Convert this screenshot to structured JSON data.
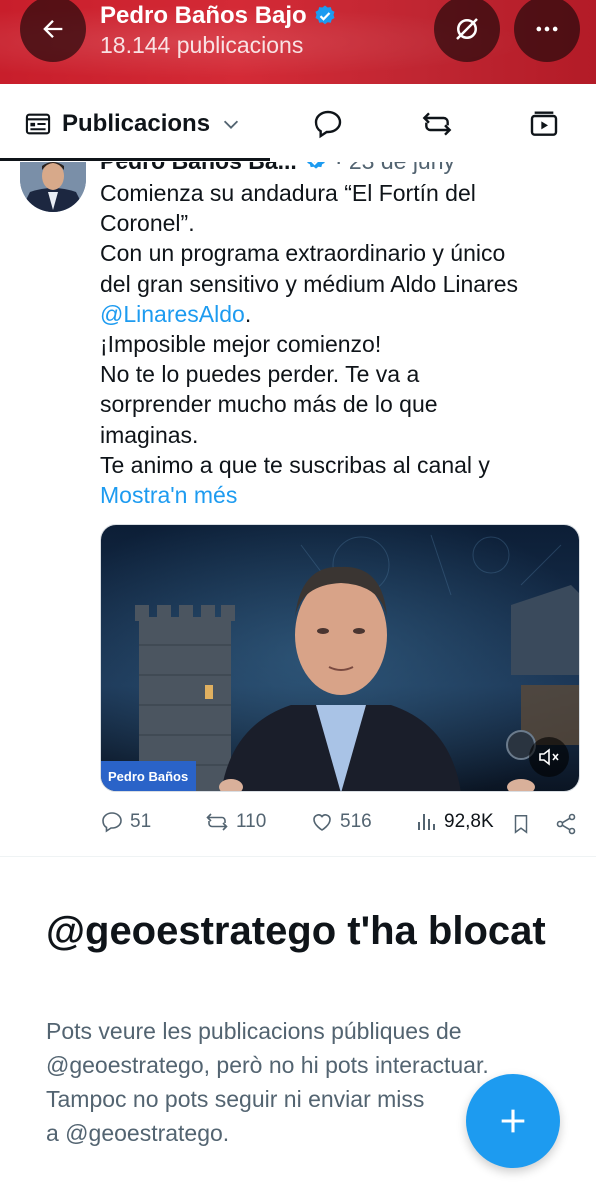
{
  "header": {
    "title": "Pedro Baños Bajo",
    "subtitle": "18.144 publicacions"
  },
  "tabs": {
    "active_label": "Publicacions"
  },
  "post": {
    "author": "Pedro Baños Ba...",
    "date": "· 23 de juny",
    "text_lines": [
      "Comienza su andadura “El Fortín del",
      "Coronel”.",
      "Con un programa extraordinario y único",
      "del gran sensitivo y médium Aldo Linares"
    ],
    "mention": "@LinaresAldo",
    "mention_suffix": ".",
    "text_lines_2": [
      "¡Imposible mejor comienzo!",
      "No te lo puedes perder. Te va a",
      "sorprender mucho más de lo que",
      "imaginas.",
      "Te animo a que te suscribas al canal y"
    ],
    "show_more": "Mostra'n més",
    "media_label": "Pedro Baños",
    "replies": "51",
    "reposts": "110",
    "likes": "516",
    "views": "92,8K"
  },
  "blocked": {
    "title": "@geoestratego t'ha blocat",
    "desc_lines": [
      "Pots veure les publicacions públiques de",
      "@geoestratego, però no hi pots interactuar.",
      "Tampoc no pots seguir ni enviar miss",
      "a @geoestratego."
    ]
  },
  "colors": {
    "header_red": "#c81e2b",
    "link_blue": "#1d9bf0",
    "text_primary": "#0f1419",
    "text_secondary": "#536471"
  },
  "icons": [
    "back-arrow-icon",
    "verified-badge-icon",
    "no-sync-icon",
    "more-icon",
    "feed-icon",
    "chevron-down-icon",
    "reply-icon",
    "repost-icon",
    "media-icon",
    "like-icon",
    "views-icon",
    "bookmark-icon",
    "share-icon",
    "mute-icon",
    "plus-icon"
  ]
}
